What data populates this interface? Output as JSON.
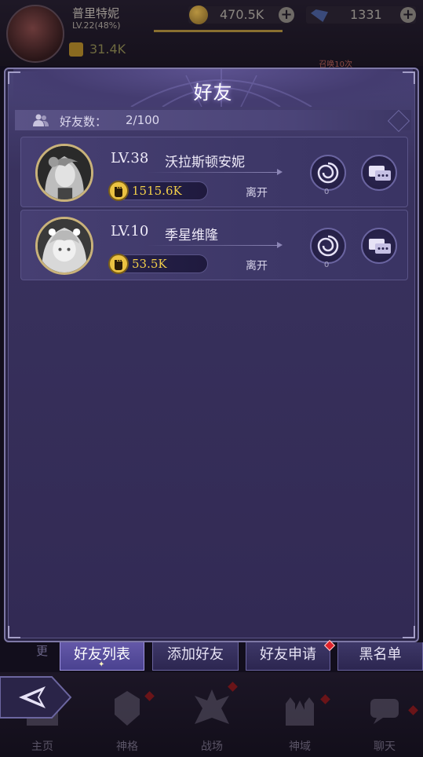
{
  "topbar": {
    "player_name": "普里特妮",
    "player_level": "LV.22(48%)",
    "gold": "470.5K",
    "gems": "1331",
    "power": "31.4K",
    "summon_text": "召唤10次"
  },
  "modal": {
    "title": "好友",
    "count_label": "好友数：",
    "count_value": "2/100"
  },
  "friends": [
    {
      "level": "LV.38",
      "name": "沃拉斯顿安妮",
      "power": "1515.6K",
      "status": "离开",
      "vortex_count": "0"
    },
    {
      "level": "LV.10",
      "name": "季星维隆",
      "power": "53.5K",
      "status": "离开",
      "vortex_count": "0"
    }
  ],
  "tabs": {
    "prev": "更",
    "items": [
      {
        "label": "好友列表",
        "active": true
      },
      {
        "label": "添加好友",
        "active": false
      },
      {
        "label": "好友申请",
        "active": false,
        "badge": true
      },
      {
        "label": "黑名单",
        "active": false
      }
    ]
  },
  "nav": {
    "items": [
      {
        "label": "主页",
        "icon": "home-icon"
      },
      {
        "label": "神格",
        "icon": "divinity-icon"
      },
      {
        "label": "战场",
        "icon": "battlefield-icon"
      },
      {
        "label": "神域",
        "icon": "castle-icon"
      },
      {
        "label": "聊天",
        "icon": "chat-icon"
      }
    ]
  },
  "colors": {
    "accent": "#6458a8",
    "power_text": "#f2cf4a",
    "badge_red": "#e0222a"
  }
}
